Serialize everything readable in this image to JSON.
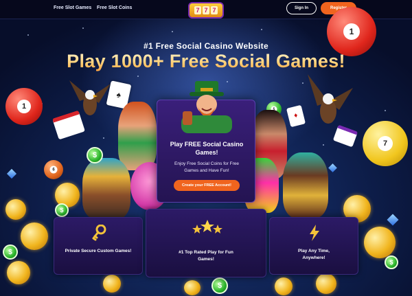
{
  "header": {
    "nav": [
      {
        "label": "Free Slot Games"
      },
      {
        "label": "Free Slot Coins"
      }
    ],
    "signin_label": "Sign In",
    "register_label": "Register"
  },
  "hero": {
    "subtitle": "#1 Free Social Casino Website",
    "headline": "Play 1000+ Free Social Games!"
  },
  "center_card": {
    "title": "Play FREE Social Casino Games!",
    "text": "Enjoy Free Social Coins for Free Games and Have Fun!",
    "button_label": "Create your FREE Account!"
  },
  "features": [
    {
      "icon": "key-icon",
      "label": "Private Secure Custom Games!"
    },
    {
      "icon": "three-stars-icon",
      "label": "#1 Top Rated Play for Fun Games!"
    },
    {
      "icon": "lightning-icon",
      "label": "Play Any Time, Anywhere!"
    }
  ],
  "colors": {
    "accent": "#f0641e",
    "header_bg": "#06081c",
    "card_bg": "#2c1a66",
    "gold": "#ffd27a"
  }
}
